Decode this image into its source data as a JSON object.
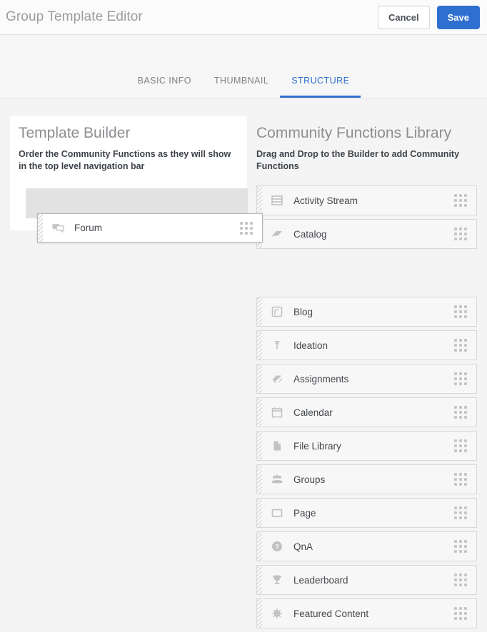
{
  "header": {
    "title": "Group Template Editor",
    "cancel_label": "Cancel",
    "save_label": "Save",
    "accent_color": "#2f6fd0"
  },
  "tabs": [
    {
      "label": "BASIC INFO",
      "active": false
    },
    {
      "label": "THUMBNAIL",
      "active": false
    },
    {
      "label": "STRUCTURE",
      "active": true
    }
  ],
  "builder": {
    "title": "Template Builder",
    "subtitle": "Order the Community Functions as they will show in the top level navigation bar",
    "placeholder_color": "#e2e2e2"
  },
  "library": {
    "title": "Community Functions Library",
    "subtitle": "Drag and Drop to the Builder to add Community Functions",
    "items": [
      {
        "label": "Activity Stream",
        "icon": "activity-stream-icon"
      },
      {
        "label": "Catalog",
        "icon": "catalog-icon"
      },
      {
        "label": "Blog",
        "icon": "blog-icon"
      },
      {
        "label": "Ideation",
        "icon": "ideation-icon"
      },
      {
        "label": "Assignments",
        "icon": "assignments-icon"
      },
      {
        "label": "Calendar",
        "icon": "calendar-icon"
      },
      {
        "label": "File Library",
        "icon": "file-icon"
      },
      {
        "label": "Groups",
        "icon": "groups-icon"
      },
      {
        "label": "Page",
        "icon": "page-icon"
      },
      {
        "label": "QnA",
        "icon": "question-icon"
      },
      {
        "label": "Leaderboard",
        "icon": "trophy-icon"
      },
      {
        "label": "Featured Content",
        "icon": "star-burst-icon"
      }
    ]
  },
  "drag": {
    "label": "Forum",
    "icon": "forum-icon"
  }
}
